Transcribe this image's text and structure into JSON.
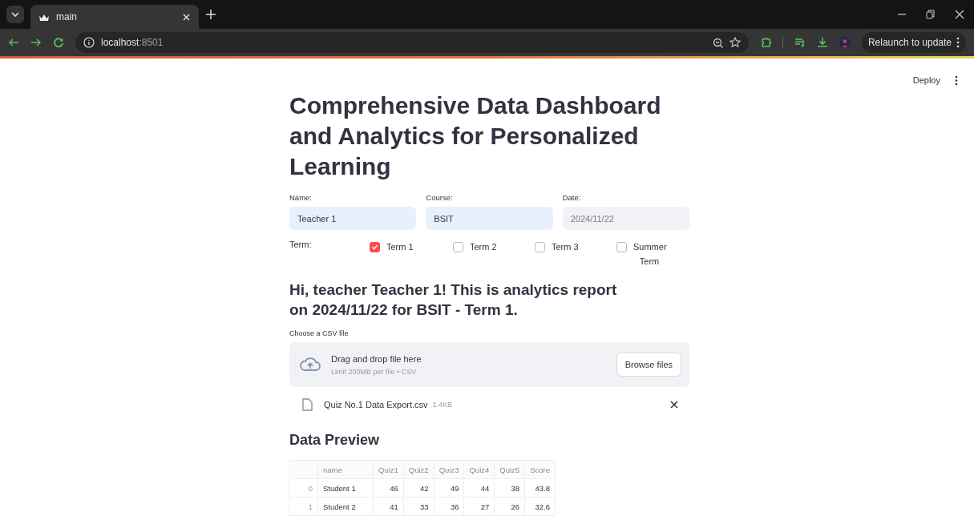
{
  "browser": {
    "tabs": [
      {
        "title": "main",
        "selected": true
      }
    ],
    "address": {
      "host": "localhost",
      "port": ":8501"
    },
    "relaunch": "Relaunch to update"
  },
  "app": {
    "deploy": "Deploy",
    "title": "Comprehensive Data Dashboard and Analytics for Personalized Learning",
    "fields": [
      {
        "label": "Name:",
        "value": "Teacher 1",
        "disabled": false
      },
      {
        "label": "Course:",
        "value": "BSIT",
        "disabled": false
      },
      {
        "label": "Date:",
        "value": "2024/11/22",
        "disabled": true
      }
    ],
    "term": {
      "label": "Term:",
      "options": [
        {
          "label": "Term 1",
          "checked": true
        },
        {
          "label": "Term 2",
          "checked": false
        },
        {
          "label": "Term 3",
          "checked": false
        },
        {
          "label": "Summer Term",
          "checked": false
        }
      ]
    },
    "greeting": "Hi, teacher Teacher 1! This is analytics report on 2024/11/22 for BSIT - Term 1.",
    "uploader": {
      "label": "Choose a CSV file",
      "title": "Drag and drop file here",
      "hint": "Limit 200MB per file • CSV",
      "button": "Browse files"
    },
    "file": {
      "name": "Quiz No.1 Data Export.csv",
      "size": "1.4KB"
    },
    "preview": {
      "heading": "Data Preview",
      "table": {
        "columns": [
          "name",
          "Quiz1",
          "Quiz2",
          "Quiz3",
          "Quiz4",
          "Quiz5",
          "Score"
        ],
        "rows": [
          {
            "index": "0",
            "cells": [
              "Student 1",
              "46",
              "42",
              "49",
              "44",
              "38",
              "43.8"
            ]
          },
          {
            "index": "1",
            "cells": [
              "Student 2",
              "41",
              "33",
              "36",
              "27",
              "26",
              "32.6"
            ]
          }
        ]
      }
    }
  }
}
